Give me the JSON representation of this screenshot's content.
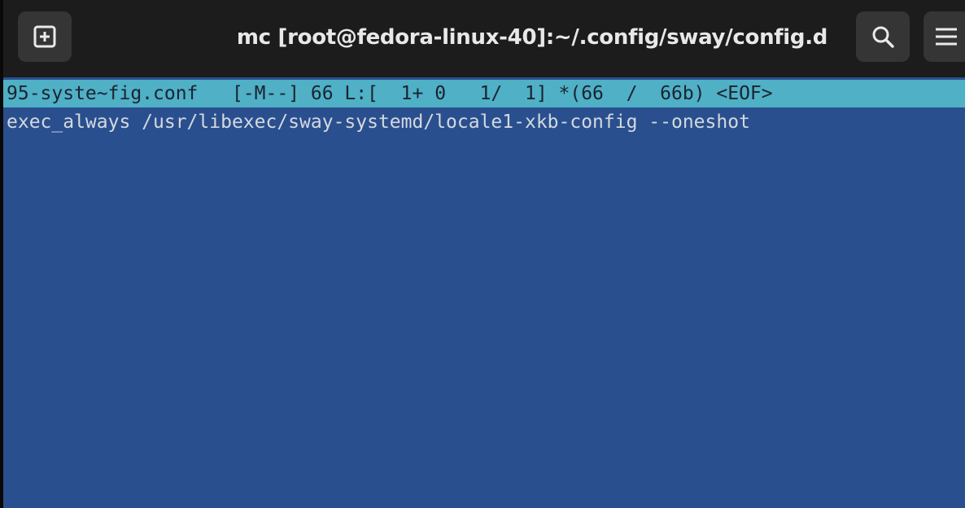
{
  "window": {
    "title": "mc [root@fedora-linux-40]:~/.config/sway/config.d"
  },
  "header": {
    "new_tab_icon": "new-tab-icon",
    "search_icon": "search-icon",
    "menu_icon": "hamburger-menu-icon"
  },
  "editor": {
    "status_line": "95-syste~fig.conf   [-M--] 66 L:[  1+ 0   1/  1] *(66  /  66b) <EOF>",
    "lines": [
      "exec_always /usr/libexec/sway-systemd/locale1-xkb-config --oneshot"
    ]
  },
  "colors": {
    "titlebar_bg": "#1c1c1c",
    "button_bg": "#353535",
    "editor_bg": "#2a4f8f",
    "status_bar_bg": "#4fb0c6"
  }
}
